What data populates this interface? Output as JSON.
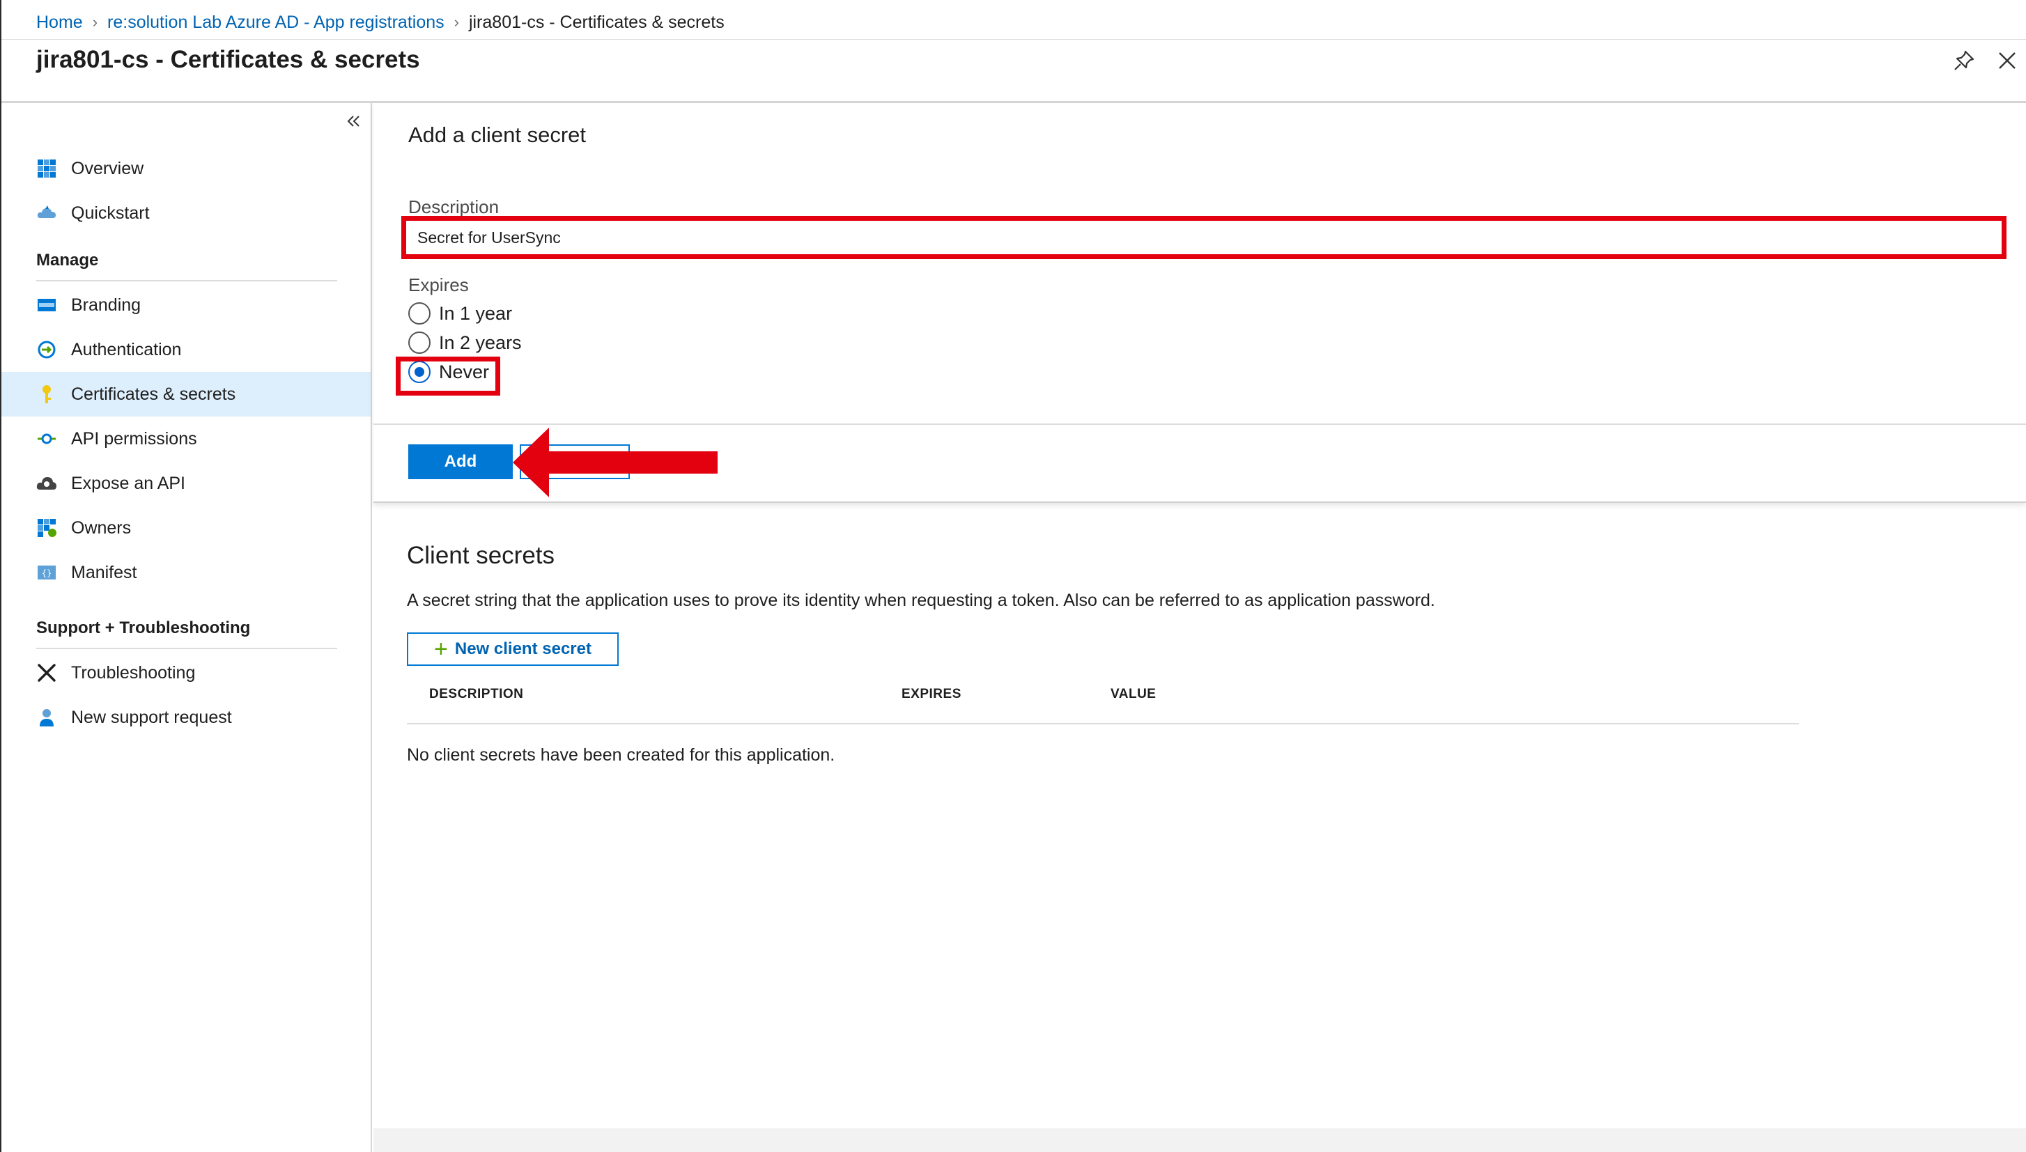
{
  "breadcrumb": {
    "items": [
      "Home",
      "re:solution Lab Azure AD - App registrations"
    ],
    "current": "jira801-cs - Certificates & secrets"
  },
  "header": {
    "title": "jira801-cs - Certificates & secrets",
    "pin_icon": "pin-icon",
    "close_icon": "close-icon"
  },
  "sidebar": {
    "collapse_icon": "double-chevron-left-icon",
    "items": [
      {
        "label": "Overview",
        "icon": "grid-icon"
      },
      {
        "label": "Quickstart",
        "icon": "cloud-icon"
      }
    ],
    "manage": {
      "heading": "Manage",
      "items": [
        {
          "label": "Branding",
          "icon": "branding-icon"
        },
        {
          "label": "Authentication",
          "icon": "authentication-icon"
        },
        {
          "label": "Certificates & secrets",
          "icon": "key-icon",
          "selected": true
        },
        {
          "label": "API permissions",
          "icon": "api-permissions-icon"
        },
        {
          "label": "Expose an API",
          "icon": "cloud-gear-icon"
        },
        {
          "label": "Owners",
          "icon": "owners-icon"
        },
        {
          "label": "Manifest",
          "icon": "manifest-icon"
        }
      ]
    },
    "support": {
      "heading": "Support + Troubleshooting",
      "items": [
        {
          "label": "Troubleshooting",
          "icon": "tools-icon"
        },
        {
          "label": "New support request",
          "icon": "support-person-icon"
        }
      ]
    }
  },
  "add_secret": {
    "title": "Add a client secret",
    "description_label": "Description",
    "description_value": "Secret for UserSync",
    "expires_label": "Expires",
    "options": [
      {
        "label": "In 1 year",
        "checked": false
      },
      {
        "label": "In 2 years",
        "checked": false
      },
      {
        "label": "Never",
        "checked": true
      }
    ],
    "add_label": "Add"
  },
  "client_secrets": {
    "title": "Client secrets",
    "description": "A secret string that the application uses to prove its identity when requesting a token. Also can be referred to as application password.",
    "new_button_label": "New client secret",
    "columns": [
      "DESCRIPTION",
      "EXPIRES",
      "VALUE"
    ],
    "empty_message": "No client secrets have been created for this application."
  },
  "colors": {
    "accent": "#0078d4",
    "link": "#0063b1",
    "highlight": "#e3000f",
    "selected_bg": "#ddeefc"
  }
}
